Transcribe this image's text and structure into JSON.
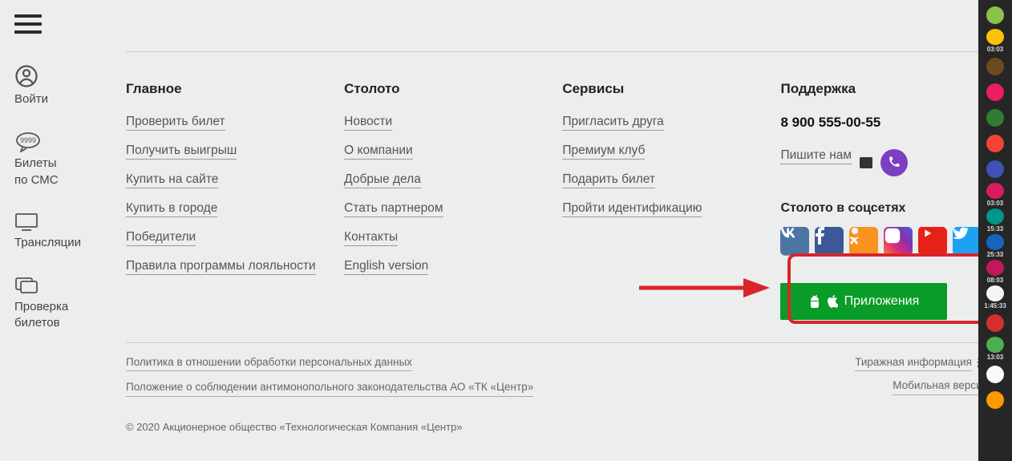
{
  "left_rail": {
    "login": "Войти",
    "tickets1": "Билеты",
    "tickets2": "по СМС",
    "tickets_badge": "9999",
    "broadcast": "Трансляции",
    "check1": "Проверка",
    "check2": "билетов"
  },
  "columns": {
    "main": {
      "title": "Главное",
      "links": [
        "Проверить билет",
        "Получить выигрыш",
        "Купить на сайте",
        "Купить в городе",
        "Победители",
        "Правила программы лояльности"
      ]
    },
    "stoloto": {
      "title": "Столото",
      "links": [
        "Новости",
        "О компании",
        "Добрые дела",
        "Стать партнером",
        "Контакты",
        "English version"
      ]
    },
    "services": {
      "title": "Сервисы",
      "links": [
        "Пригласить друга",
        "Премиум клуб",
        "Подарить билет",
        "Пройти идентификацию"
      ]
    },
    "support": {
      "title": "Поддержка",
      "phone": "8 900 555-00-55",
      "write": "Пишите нам",
      "social_title": "Столото в соцсетях",
      "app_button": "Приложения"
    }
  },
  "bottom": {
    "privacy": "Политика в отношении обработки персональных данных",
    "antimonopoly": "Положение о соблюдении антимонопольного законодательства АО «ТК «Центр»",
    "rss": "Тиражная информация",
    "mobile": "Мобильная версия",
    "copyright": "© 2020 Акционерное общество «Технологическая Компания «Центр»"
  },
  "widgets": [
    {
      "color": "#8bc34a",
      "time": ""
    },
    {
      "color": "#ffc107",
      "time": "03:03"
    },
    {
      "color": "#6b4a1f",
      "time": ""
    },
    {
      "color": "#e91e63",
      "time": ""
    },
    {
      "color": "#2e7d32",
      "time": ""
    },
    {
      "color": "#f44336",
      "time": ""
    },
    {
      "color": "#3f51b5",
      "time": ""
    },
    {
      "color": "#d81b60",
      "time": "03:03"
    },
    {
      "color": "#009688",
      "time": "15:33"
    },
    {
      "color": "#1565c0",
      "time": "25:33"
    },
    {
      "color": "#c2185b",
      "time": "08:03"
    },
    {
      "color": "#f5f5f5",
      "time": "1:45:33"
    },
    {
      "color": "#d32f2f",
      "time": ""
    },
    {
      "color": "#4caf50",
      "time": "13:03"
    },
    {
      "color": "#fafafa",
      "time": ""
    },
    {
      "color": "#ff9800",
      "time": ""
    }
  ]
}
